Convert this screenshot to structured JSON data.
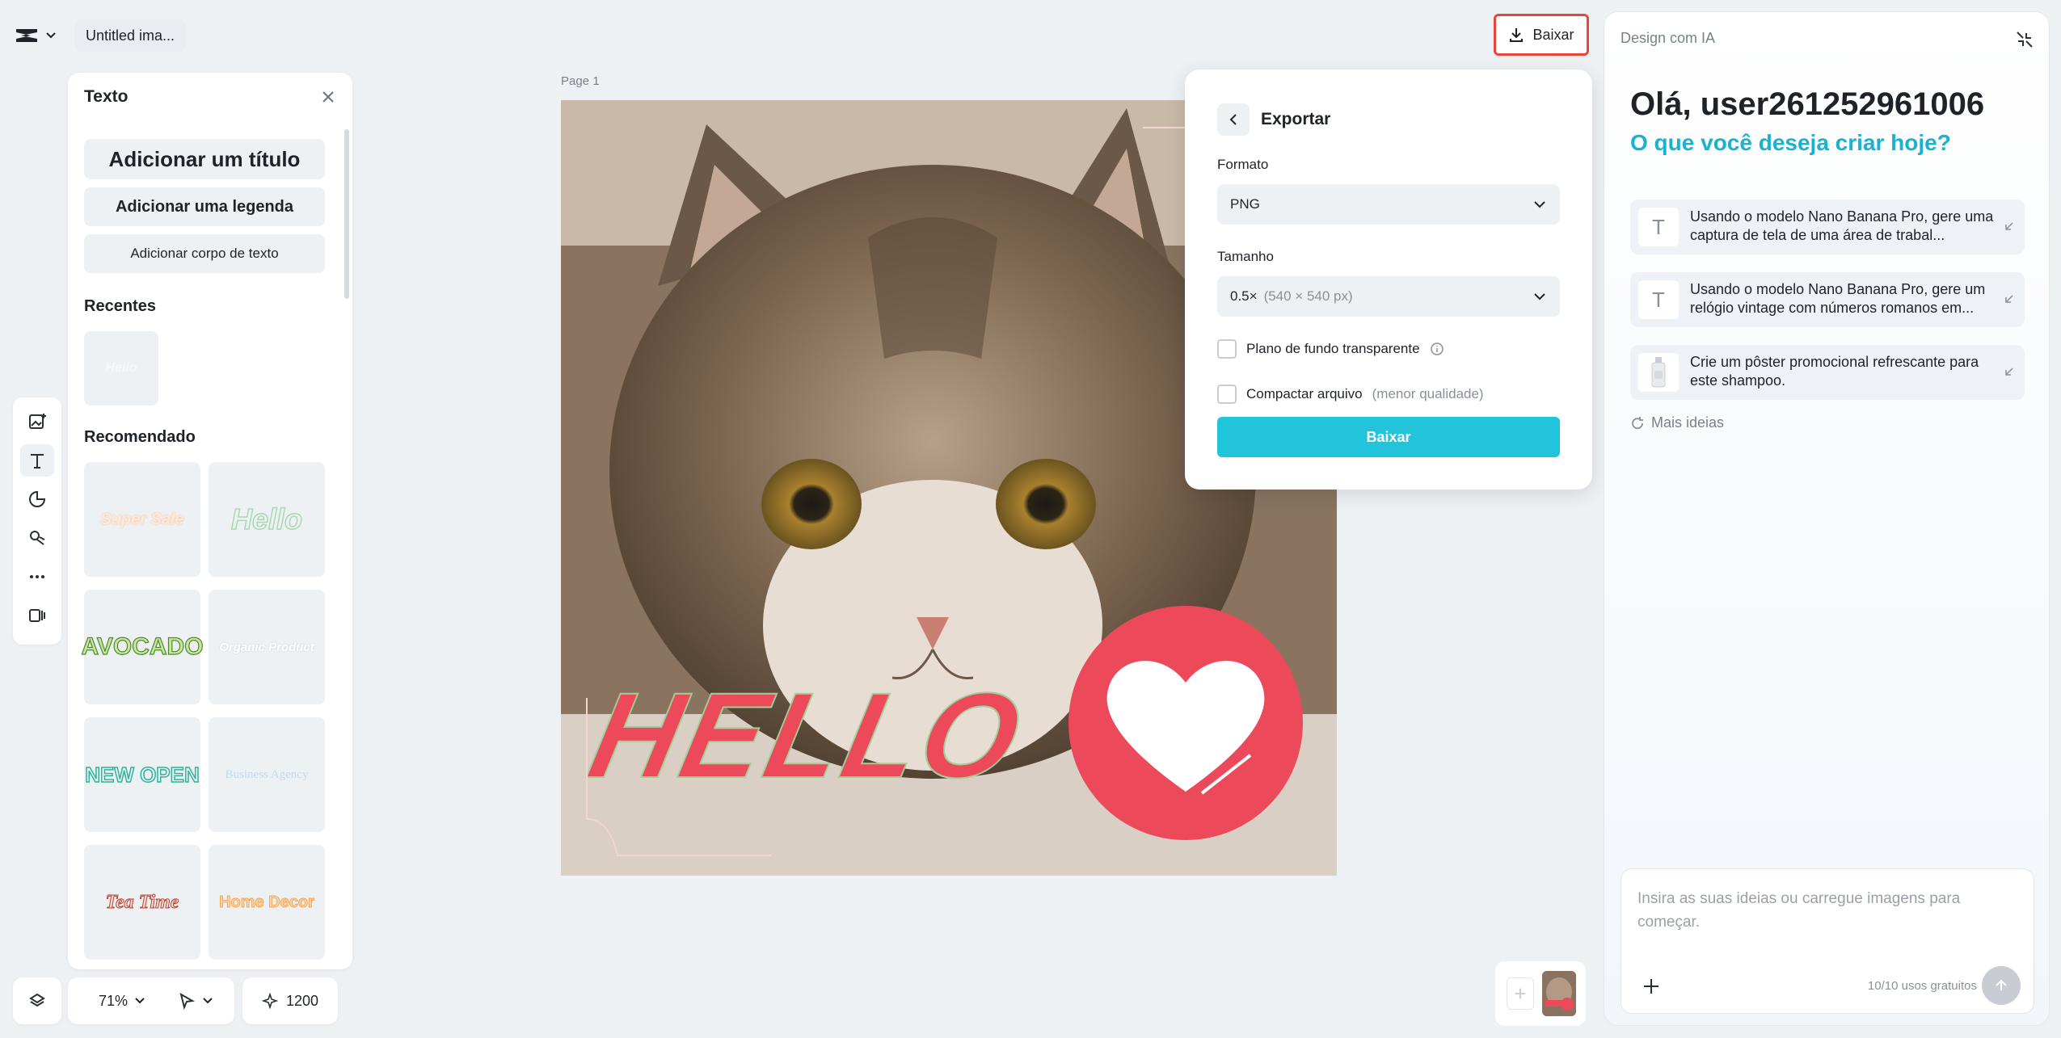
{
  "topbar": {
    "doc_title": "Untitled ima...",
    "download_label": "Baixar"
  },
  "text_panel": {
    "title": "Texto",
    "add_title": "Adicionar um título",
    "add_caption": "Adicionar uma legenda",
    "add_body": "Adicionar corpo de texto",
    "recent_title": "Recentes",
    "recent_thumb": "Hello",
    "recommended_title": "Recomendado",
    "templates": [
      "Super Sale",
      "Hello",
      "AVOCADO",
      "Organic Product",
      "NEW OPEN",
      "Business Agency",
      "Tea Time",
      "Home Decor"
    ]
  },
  "canvas": {
    "page_label": "Page 1",
    "hello_text": "HELLO"
  },
  "export": {
    "title": "Exportar",
    "format_label": "Formato",
    "format_value": "PNG",
    "size_label": "Tamanho",
    "size_value": "0.5×",
    "size_detail": "(540 × 540 px)",
    "transparent_label": "Plano de fundo transparente",
    "compress_label": "Compactar arquivo",
    "compress_note": "(menor qualidade)",
    "download_label": "Baixar"
  },
  "ai_panel": {
    "title": "Design com IA",
    "greeting": "Olá, user261252961006",
    "subtitle": "O que você deseja criar hoje?",
    "ideas": [
      "Usando o modelo Nano Banana Pro, gere uma captura de tela de uma área de trabal...",
      "Usando o modelo Nano Banana Pro, gere um relógio vintage com números romanos em...",
      "Crie um pôster promocional refrescante para este shampoo."
    ],
    "more_ideas": "Mais ideias",
    "input_placeholder": "Insira as suas ideias ou carregue imagens para começar.",
    "usage": "10/10 usos gratuitos"
  },
  "bottom": {
    "zoom": "71%",
    "credits": "1200"
  },
  "colors": {
    "accent": "#22c4dc",
    "subtitle": "#1ab2d0",
    "highlight_border": "#e8453c",
    "heart_red": "#ec4a5a"
  }
}
